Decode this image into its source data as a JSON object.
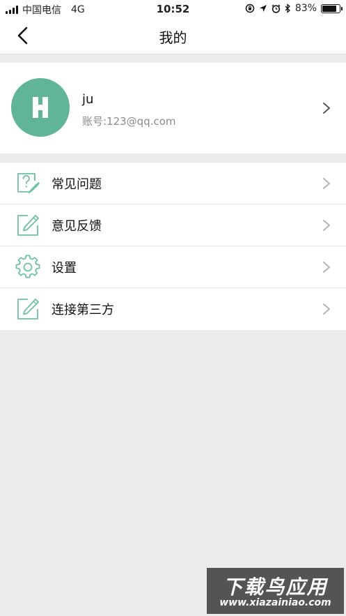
{
  "status_bar": {
    "carrier": "中国电信",
    "network": "4G",
    "time": "10:52",
    "battery_percent": "83%",
    "battery_level": 0.83
  },
  "nav": {
    "title": "我的"
  },
  "profile": {
    "avatar_letter": "H",
    "avatar_color": "#5fb596",
    "name": "ju",
    "account": "账号:123@qq.com"
  },
  "menu": {
    "items": [
      {
        "label": "常见问题",
        "icon": "faq-icon"
      },
      {
        "label": "意见反馈",
        "icon": "edit-icon"
      },
      {
        "label": "设置",
        "icon": "gear-icon"
      },
      {
        "label": "连接第三方",
        "icon": "edit-icon"
      }
    ]
  },
  "watermark": {
    "title": "下载鸟应用",
    "url": "www.xiazainiao.com"
  },
  "colors": {
    "accent": "#5fb596",
    "icon_stroke": "#6cc1a3"
  }
}
